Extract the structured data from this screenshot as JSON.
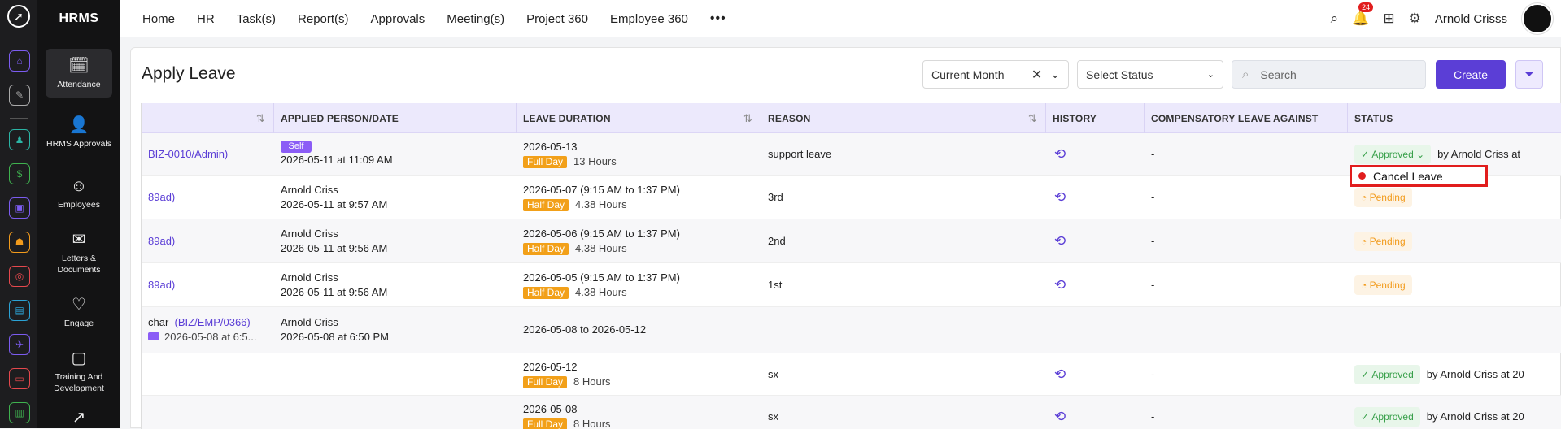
{
  "app": {
    "brand": "HRMS",
    "user_name": "Arnold Crisss",
    "notification_count": "24"
  },
  "nav": [
    "Home",
    "HR",
    "Task(s)",
    "Report(s)",
    "Approvals",
    "Meeting(s)",
    "Project 360",
    "Employee 360"
  ],
  "sidebar": [
    {
      "label": "Attendance",
      "icon": "calendar-clock-icon",
      "active": true
    },
    {
      "label": "HRMS Approvals",
      "icon": "user-check-icon"
    },
    {
      "label": "Employees",
      "icon": "user-icon"
    },
    {
      "label": "Letters & Documents",
      "icon": "envelope-icon"
    },
    {
      "label": "Engage",
      "icon": "handshake-icon"
    },
    {
      "label": "Training And Development",
      "icon": "presentation-icon"
    }
  ],
  "page": {
    "title": "Apply Leave",
    "period_filter": "Current Month",
    "status_filter": "Select Status",
    "search_placeholder": "Search",
    "create_label": "Create"
  },
  "columns": [
    "APPLIED PERSON/DATE",
    "LEAVE DURATION",
    "REASON",
    "HISTORY",
    "COMPENSATORY LEAVE AGAINST",
    "STATUS"
  ],
  "rows": [
    {
      "emp": "BIZ-0010/Admin)",
      "person": "Self",
      "applied": "2026-05-11 at 11:09 AM",
      "duration": "2026-05-13",
      "day_type": "Full Day",
      "hours": "13 Hours",
      "reason": "support leave",
      "comp": "-",
      "status": "Approved",
      "by": "by Arnold Criss at"
    },
    {
      "emp": "89ad)",
      "person": "Arnold Criss",
      "applied": "2026-05-11 at 9:57 AM",
      "duration": "2026-05-07 (9:15 AM to 1:37 PM)",
      "day_type": "Half Day",
      "hours": "4.38 Hours",
      "reason": "3rd",
      "comp": "-",
      "status": "Pending",
      "by": ""
    },
    {
      "emp": "89ad)",
      "person": "Arnold Criss",
      "applied": "2026-05-11 at 9:56 AM",
      "duration": "2026-05-06 (9:15 AM to 1:37 PM)",
      "day_type": "Half Day",
      "hours": "4.38 Hours",
      "reason": "2nd",
      "comp": "-",
      "status": "Pending",
      "by": ""
    },
    {
      "emp": "89ad)",
      "person": "Arnold Criss",
      "applied": "2026-05-11 at 9:56 AM",
      "duration": "2026-05-05 (9:15 AM to 1:37 PM)",
      "day_type": "Half Day",
      "hours": "4.38 Hours",
      "reason": "1st",
      "comp": "-",
      "status": "Pending",
      "by": ""
    },
    {
      "emp_prefix": "char",
      "emp": "(BIZ/EMP/0366)",
      "emp_sub": "2026-05-08 at 6:5...",
      "person": "Arnold Criss",
      "applied": "2026-05-08 at 6:50 PM",
      "duration": "2026-05-08 to 2026-05-12"
    },
    {
      "duration": "2026-05-12",
      "day_type": "Full Day",
      "hours": "8 Hours",
      "reason": "sx",
      "comp": "-",
      "status": "Approved",
      "by": "by Arnold Criss at 20"
    },
    {
      "duration": "2026-05-08",
      "day_type": "Full Day",
      "hours": "8 Hours",
      "reason": "sx",
      "comp": "-",
      "status": "Approved",
      "by": "by Arnold Criss at 20"
    }
  ],
  "dropdown": {
    "cancel_label": "Cancel Leave"
  }
}
